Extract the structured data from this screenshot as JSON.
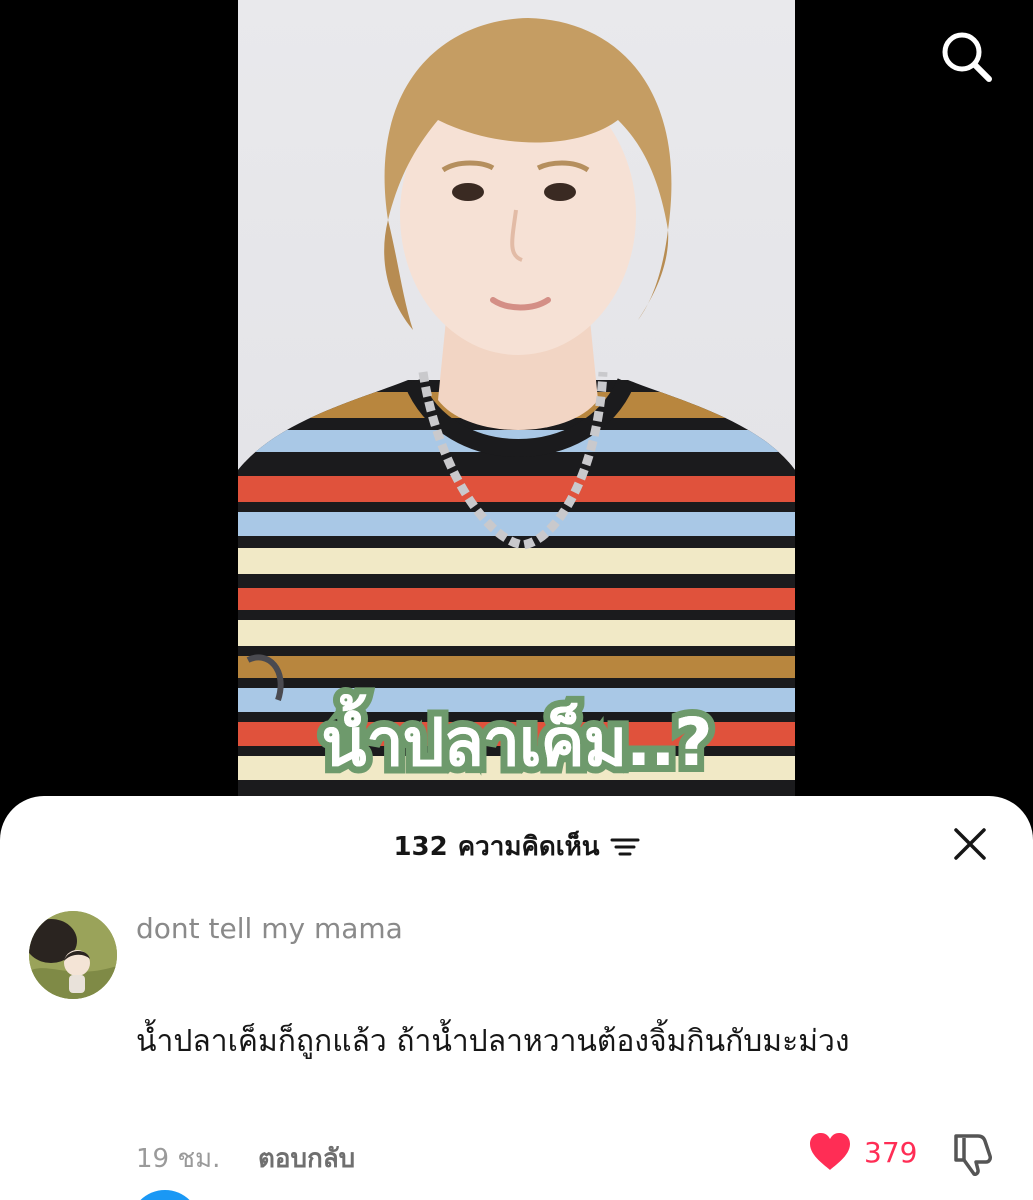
{
  "video": {
    "caption": "น้ำปลาเค็ม..?",
    "caption_outline_color": "#6e9a6c"
  },
  "top_bar": {
    "search_icon": "search-icon"
  },
  "comments_sheet": {
    "count": "132",
    "title": "ความคิดเห็น",
    "sort_icon": "sort-icon",
    "close_icon": "close-icon",
    "comments": [
      {
        "username": "dont tell my mama",
        "text": "น้ำปลาเค็มก็ถูกแล้ว ถ้าน้ำปลาหวานต้องจิ้มกินกับมะม่วง",
        "time": "19 ชม.",
        "reply_label": "ตอบกลับ",
        "likes": "379",
        "liked": true,
        "like_color": "#ff2d55"
      }
    ]
  }
}
